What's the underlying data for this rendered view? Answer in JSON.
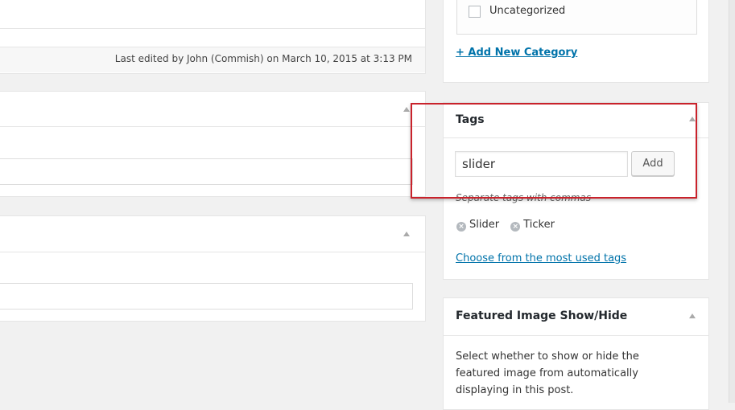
{
  "editor": {
    "last_edited": "Last edited by John (Commish) on March 10, 2015 at 3:13 PM"
  },
  "categories": {
    "item_label": "Uncategorized",
    "add_link": "+ Add New Category"
  },
  "tags": {
    "title": "Tags",
    "input_value": "slider",
    "add_button": "Add",
    "hint": "Separate tags with commas",
    "items": [
      {
        "label": "Slider",
        "remove_icon": "x-circle-icon"
      },
      {
        "label": "Ticker",
        "remove_icon": "x-circle-icon"
      }
    ],
    "most_used_link": "Choose from the most used tags"
  },
  "featured_image": {
    "title": "Featured Image Show/Hide",
    "description_line1": "Select whether to show or hide the",
    "description_line2": "featured image from automatically",
    "description_line3": "displaying in this post."
  },
  "colors": {
    "link": "#0073aa",
    "highlight": "#c9222b",
    "background": "#f1f1f1"
  }
}
